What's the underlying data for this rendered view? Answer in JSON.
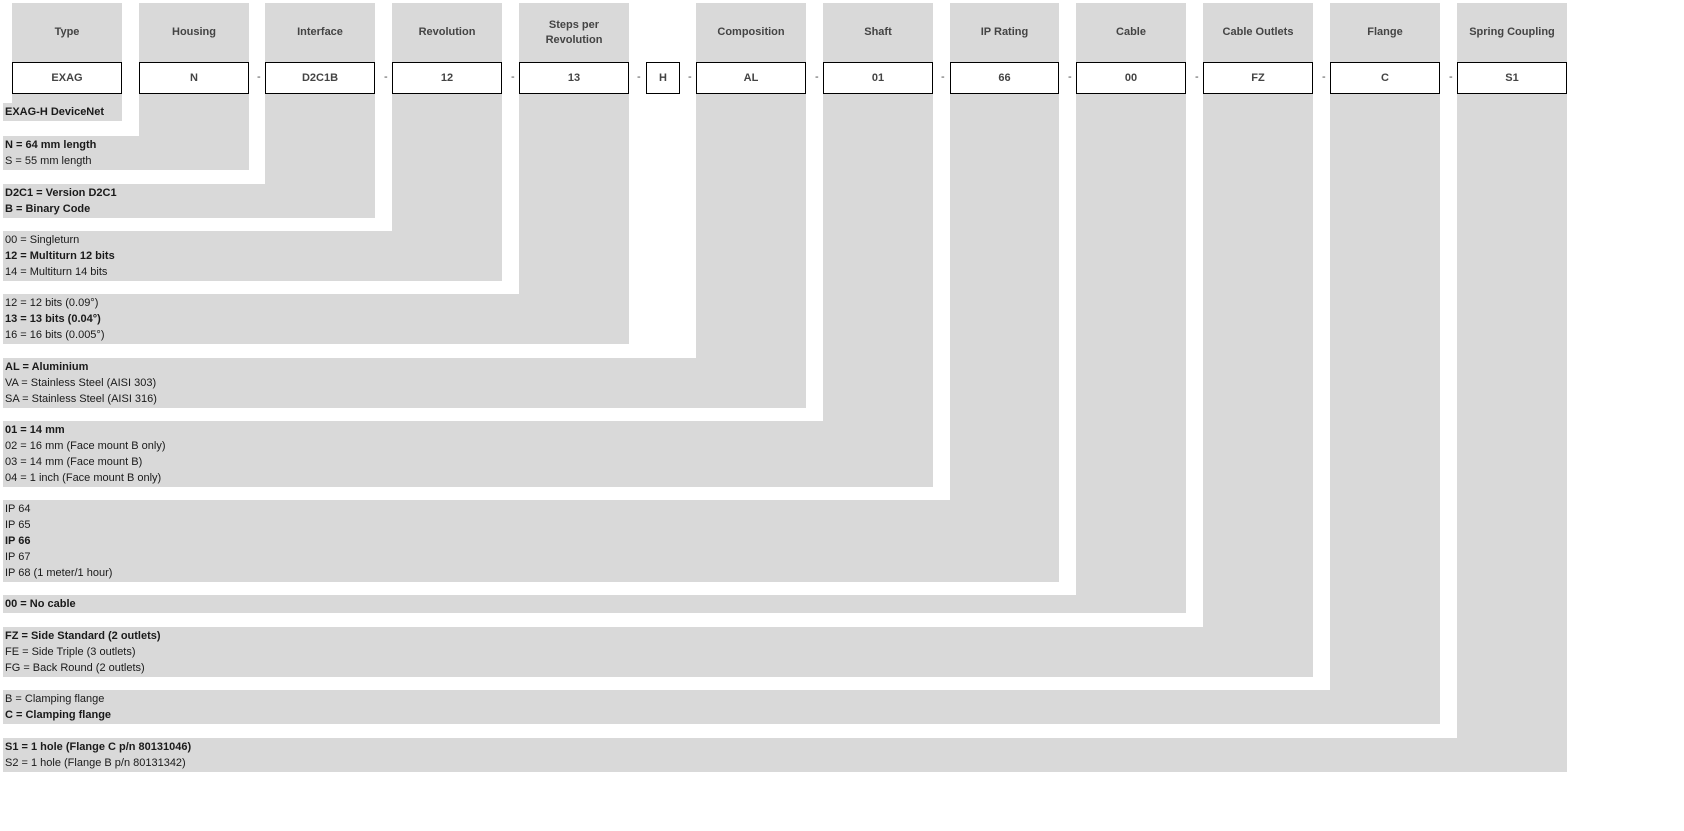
{
  "columns": [
    {
      "header": "Type",
      "value": "EXAG",
      "options": [
        {
          "text": "EXAG-H DeviceNet",
          "selected": true
        }
      ]
    },
    {
      "header": "Housing",
      "value": "N",
      "options": [
        {
          "text": "N = 64 mm length",
          "selected": true
        },
        {
          "text": "S = 55 mm length",
          "selected": false
        }
      ]
    },
    {
      "header": "Interface",
      "value": "D2C1B",
      "options": [
        {
          "text": "D2C1 = Version D2C1",
          "selected": true
        },
        {
          "text": "B = Binary Code",
          "selected": true
        }
      ]
    },
    {
      "header": "Revolution",
      "value": "12",
      "options": [
        {
          "text": "00 = Singleturn",
          "selected": false
        },
        {
          "text": "12 = Multiturn 12 bits",
          "selected": true
        },
        {
          "text": "14 = Multiturn 14 bits",
          "selected": false
        }
      ]
    },
    {
      "header": "Steps per Revolution",
      "value": "13",
      "options": [
        {
          "text": "12 = 12 bits (0.09°)",
          "selected": false
        },
        {
          "text": "13 = 13 bits (0.04°)",
          "selected": true
        },
        {
          "text": "16 = 16 bits (0.005°)",
          "selected": false
        }
      ]
    },
    {
      "header": "",
      "value": "H",
      "options": []
    },
    {
      "header": "Composition",
      "value": "AL",
      "options": [
        {
          "text": "AL = Aluminium",
          "selected": true
        },
        {
          "text": "VA = Stainless Steel (AISI 303)",
          "selected": false
        },
        {
          "text": "SA = Stainless Steel (AISI 316)",
          "selected": false
        }
      ]
    },
    {
      "header": "Shaft",
      "value": "01",
      "options": [
        {
          "text": "01 = 14 mm",
          "selected": true
        },
        {
          "text": "02 = 16 mm (Face mount B only)",
          "selected": false
        },
        {
          "text": "03 = 14 mm (Face mount B)",
          "selected": false
        },
        {
          "text": "04 = 1 inch (Face mount B only)",
          "selected": false
        }
      ]
    },
    {
      "header": "IP Rating",
      "value": "66",
      "options": [
        {
          "text": "IP 64",
          "selected": false
        },
        {
          "text": "IP 65",
          "selected": false
        },
        {
          "text": "IP 66",
          "selected": true
        },
        {
          "text": "IP 67",
          "selected": false
        },
        {
          "text": "IP 68 (1 meter/1 hour)",
          "selected": false
        }
      ]
    },
    {
      "header": "Cable",
      "value": "00",
      "options": [
        {
          "text": "00 = No cable",
          "selected": true
        }
      ]
    },
    {
      "header": "Cable Outlets",
      "value": "FZ",
      "options": [
        {
          "text": "FZ = Side Standard (2 outlets)",
          "selected": true
        },
        {
          "text": "FE = Side Triple (3 outlets)",
          "selected": false
        },
        {
          "text": "FG = Back Round (2 outlets)",
          "selected": false
        }
      ]
    },
    {
      "header": "Flange",
      "value": "C",
      "options": [
        {
          "text": "B = Clamping flange",
          "selected": false
        },
        {
          "text": "C = Clamping flange",
          "selected": true
        }
      ]
    },
    {
      "header": "Spring Coupling",
      "value": "S1",
      "options": [
        {
          "text": "S1 = 1 hole (Flange C p/n 80131046)",
          "selected": true
        },
        {
          "text": "S2 = 1 hole (Flange B p/n 80131342)",
          "selected": false
        }
      ]
    }
  ],
  "separator": "-",
  "colors": {
    "panel": "#d9d9d9",
    "border": "#000000"
  }
}
